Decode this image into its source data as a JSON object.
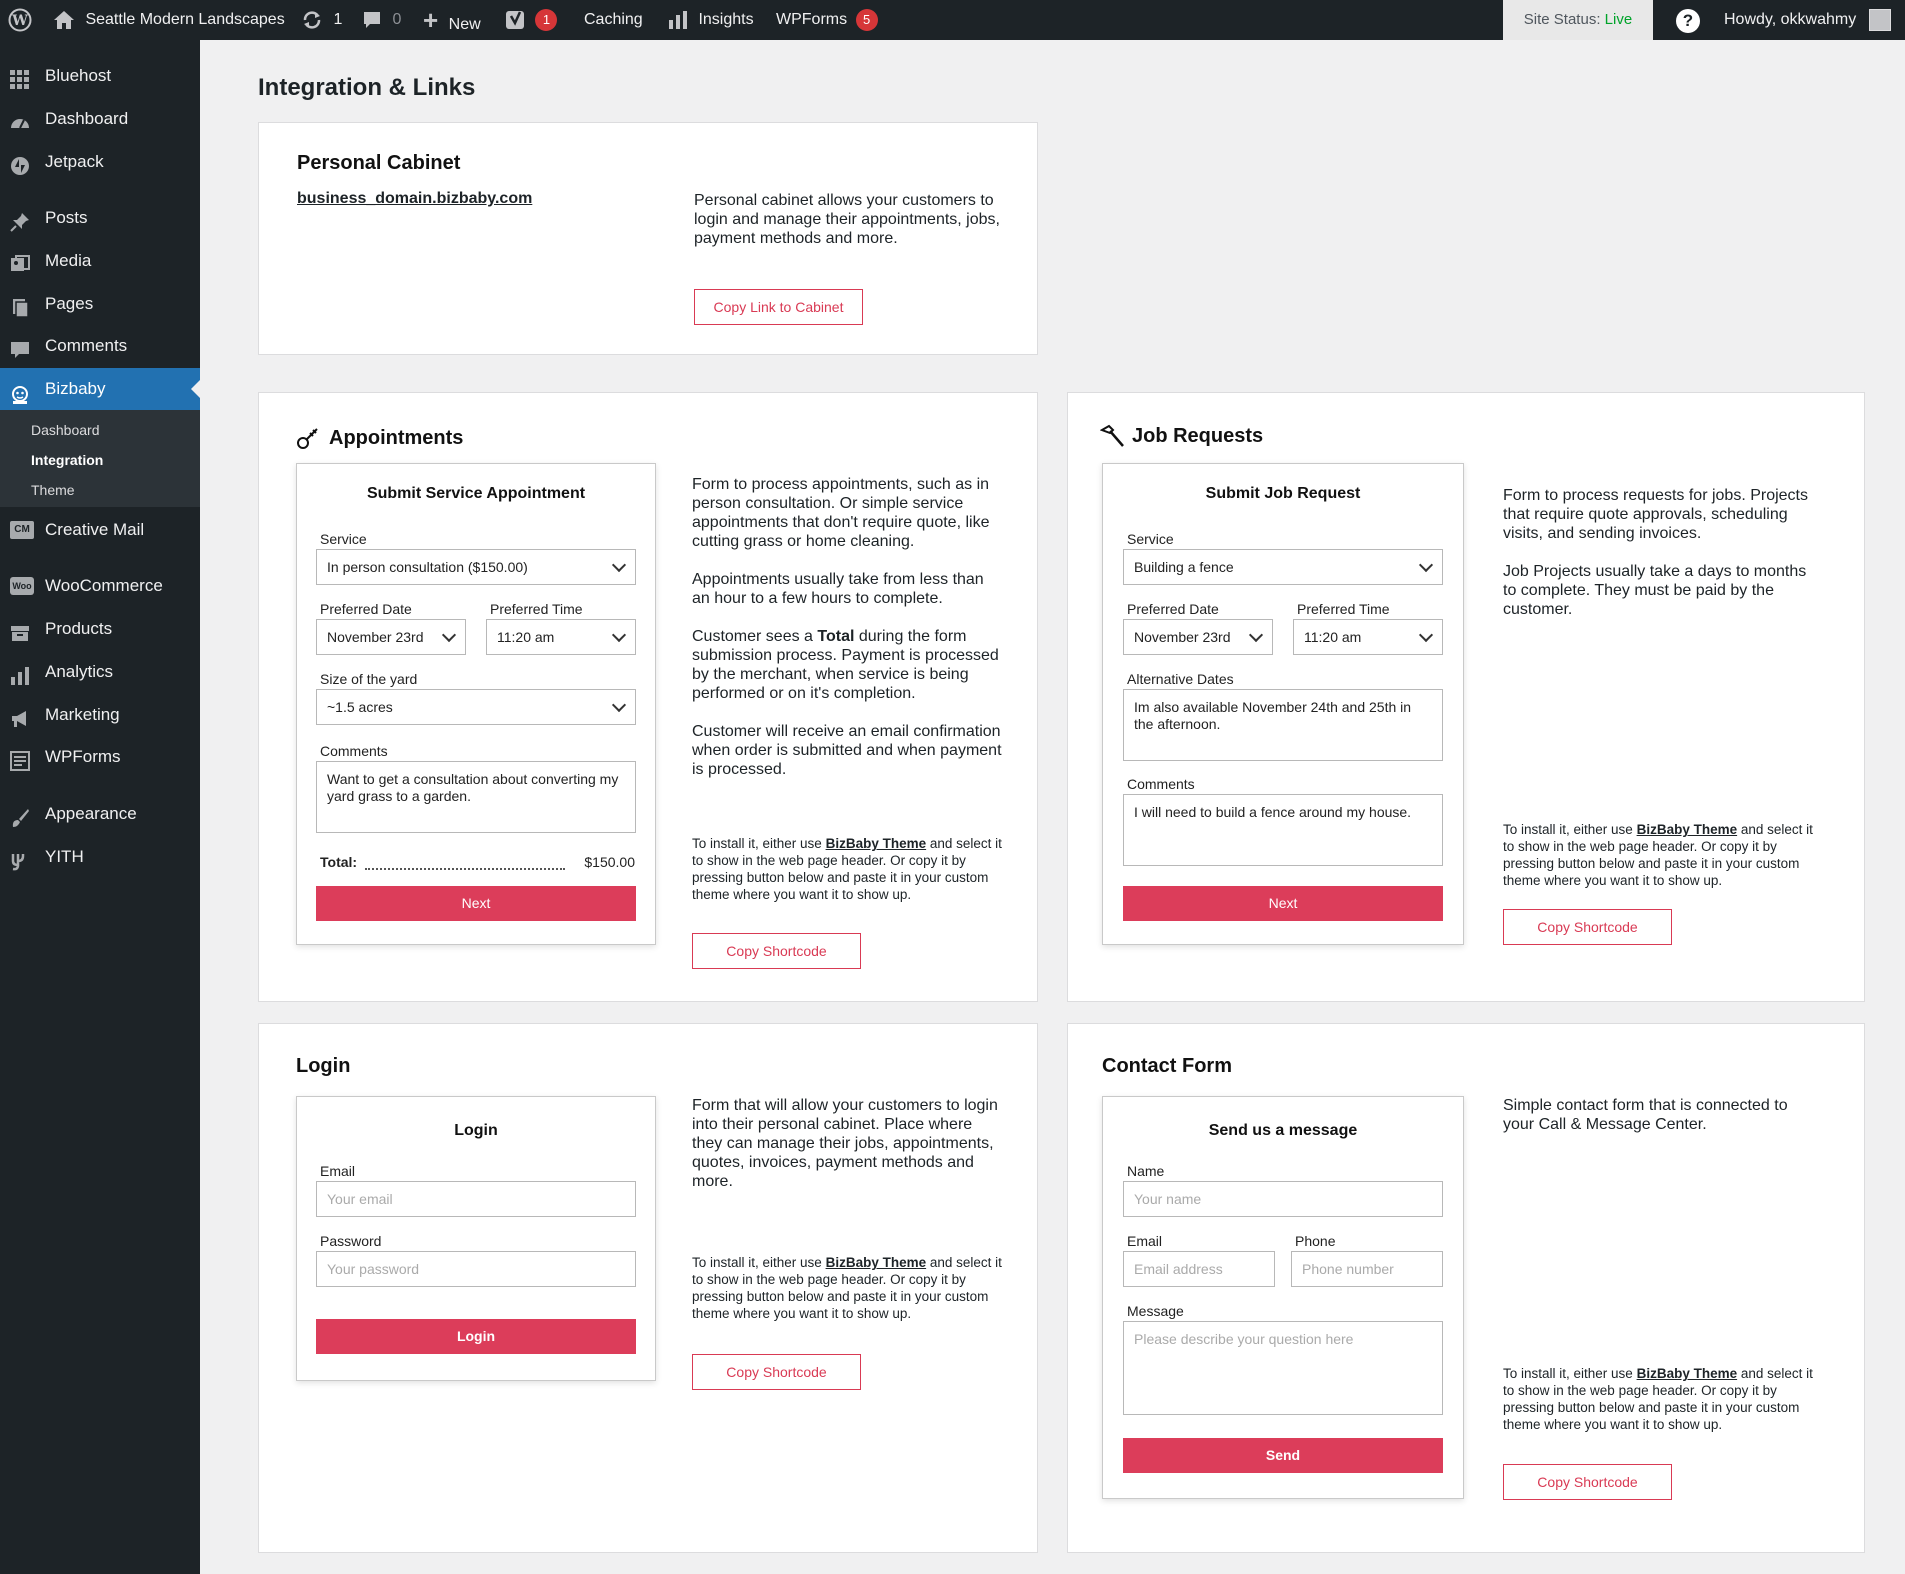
{
  "adminbar": {
    "site_name": "Seattle Modern Landscapes",
    "updates_count": "1",
    "comments_count": "0",
    "new_label": "New",
    "yoast_count": "1",
    "caching_label": "Caching",
    "insights_label": "Insights",
    "wpforms_label": "WPForms",
    "wpforms_count": "5",
    "site_status_label": "Site Status:",
    "site_status_value": "Live",
    "help_label": "?",
    "howdy": "Howdy, okkwahmy"
  },
  "sidebar": {
    "items": [
      {
        "label": "Bluehost",
        "icon": "grid-icon"
      },
      {
        "label": "Dashboard",
        "icon": "dashboard-icon"
      },
      {
        "label": "Jetpack",
        "icon": "jetpack-icon"
      },
      {
        "label": "Posts",
        "icon": "pin-icon"
      },
      {
        "label": "Media",
        "icon": "media-icon"
      },
      {
        "label": "Pages",
        "icon": "pages-icon"
      },
      {
        "label": "Comments",
        "icon": "comment-icon"
      },
      {
        "label": "Bizbaby",
        "icon": "bizbaby-icon"
      },
      {
        "label": "Creative Mail",
        "icon": "cm-icon"
      },
      {
        "label": "WooCommerce",
        "icon": "woo-icon"
      },
      {
        "label": "Products",
        "icon": "products-icon"
      },
      {
        "label": "Analytics",
        "icon": "analytics-icon"
      },
      {
        "label": "Marketing",
        "icon": "megaphone-icon"
      },
      {
        "label": "WPForms",
        "icon": "wpforms-icon"
      },
      {
        "label": "Appearance",
        "icon": "brush-icon"
      },
      {
        "label": "YITH",
        "icon": "yith-icon"
      }
    ],
    "cm_badge": "CM",
    "woo_badge": "Woo",
    "submenu": [
      "Dashboard",
      "Integration",
      "Theme"
    ]
  },
  "page": {
    "title": "Integration & Links"
  },
  "cabinet": {
    "title": "Personal Cabinet",
    "link": "business_domain.bizbaby.com",
    "description": "Personal cabinet allows your customers to login and manage their appointments, jobs, payment methods and more.",
    "button": "Copy Link to Cabinet"
  },
  "install_note": {
    "prefix": "To install it, either use ",
    "link": "BizBaby Theme",
    "suffix": " and select it to show in the web page header. Or copy it  by pressing button below and paste it in your custom theme where you want it to show up."
  },
  "appointments": {
    "title": "Appointments",
    "form_title": "Submit Service Appointment",
    "service_label": "Service",
    "service_value": "In person consultation ($150.00)",
    "date_label": "Preferred Date",
    "date_value": "November 23rd",
    "time_label": "Preferred Time",
    "time_value": "11:20 am",
    "size_label": "Size of the yard",
    "size_value": "~1.5 acres",
    "comments_label": "Comments",
    "comments_value": "Want to get a consultation about converting my yard grass to a garden.",
    "total_label": "Total:",
    "total_value": "$150.00",
    "next": "Next",
    "desc1": "Form to process appointments, such as in person consultation. Or simple service appointments that don't require quote, like cutting grass or home cleaning.",
    "desc2": "Appointments usually take from less than an hour to a few hours to complete.",
    "desc3_a": "Customer sees a ",
    "desc3_b": "Total",
    "desc3_c": " during the form submission process. Payment is processed by the merchant, when service is being performed or on it's completion.",
    "desc4": "Customer will receive an email confirmation when order is submitted and when payment is processed.",
    "button": "Copy Shortcode"
  },
  "jobs": {
    "title": "Job Requests",
    "form_title": "Submit Job Request",
    "service_label": "Service",
    "service_value": "Building a fence",
    "date_label": "Preferred Date",
    "date_value": "November 23rd",
    "time_label": "Preferred Time",
    "time_value": "11:20 am",
    "alt_label": "Alternative Dates",
    "alt_value": "Im also available November 24th and 25th in the afternoon.",
    "comments_label": "Comments",
    "comments_value": "I will need to build a fence around my house.",
    "next": "Next",
    "desc1": "Form to process requests for jobs. Projects that require quote approvals, scheduling visits, and sending invoices.",
    "desc2": "Job Projects usually take a days to months to complete. They must be paid by the customer.",
    "button": "Copy Shortcode"
  },
  "login": {
    "title": "Login",
    "form_title": "Login",
    "email_label": "Email",
    "email_placeholder": "Your email",
    "password_label": "Password",
    "password_placeholder": "Your password",
    "submit": "Login",
    "desc1": "Form that will allow your customers to login into their personal cabinet. Place where they can manage their jobs, appointments, quotes, invoices, payment methods and more.",
    "button": "Copy Shortcode"
  },
  "contact": {
    "title": "Contact Form",
    "form_title": "Send us a message",
    "name_label": "Name",
    "name_placeholder": "Your name",
    "email_label": "Email",
    "email_placeholder": "Email address",
    "phone_label": "Phone",
    "phone_placeholder": "Phone number",
    "message_label": "Message",
    "message_placeholder": "Please describe your question here",
    "submit": "Send",
    "desc1": "Simple contact form that is connected to your Call & Message Center.",
    "button": "Copy Shortcode"
  },
  "colors": {
    "accent": "#dc3d5a",
    "admin_bg": "#1d2327",
    "active_menu": "#2271b1",
    "live": "#00a32a"
  }
}
